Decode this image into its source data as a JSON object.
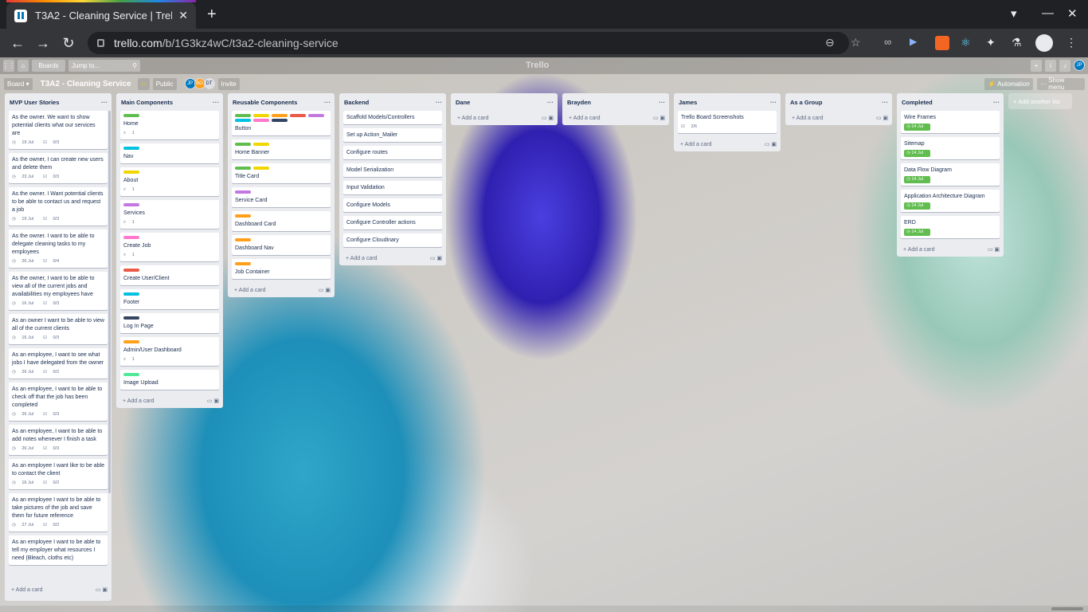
{
  "browser": {
    "tab_title": "T3A2 - Cleaning Service | Trello",
    "url_domain": "trello.com",
    "url_path": "/b/1G3kz4wC/t3a2-cleaning-service"
  },
  "topbar": {
    "boards_label": "Boards",
    "search_placeholder": "Jump to...",
    "logo": "Trello",
    "user_initials": "JP"
  },
  "board": {
    "view_label": "Board",
    "title": "T3A2 - Cleaning Service",
    "visibility": "Public",
    "invite_label": "Invite",
    "members": [
      "JP",
      "BG",
      "DT"
    ],
    "automation_label": "Automation",
    "show_menu_label": "Show menu",
    "add_list_label": "Add another list",
    "add_card_label": "Add a card"
  },
  "colors": {
    "green": "#61bd4f",
    "yellow": "#f2d600",
    "orange": "#ff9f1a",
    "red": "#eb5a46",
    "purple": "#c377e0",
    "blue": "#0079bf",
    "sky": "#00c2e0",
    "pink": "#ff78cb",
    "black": "#344563",
    "lime": "#51e898"
  },
  "lists": [
    {
      "name": "MVP User Stories",
      "cards": [
        {
          "title": "As the owner. We want to show potential clients what our services are",
          "due": "19 Jul",
          "check": "0/3"
        },
        {
          "title": "As the owner, I can create new users and delete them",
          "due": "23 Jul",
          "check": "0/3"
        },
        {
          "title": "As the owner. I Want potential clients to be able to contact us and request a job",
          "due": "19 Jul",
          "check": "0/3"
        },
        {
          "title": "As the owner. I want to be able to delegate cleaning tasks to my employees",
          "due": "26 Jul",
          "check": "0/4"
        },
        {
          "title": "As the owner, I want to be able to view all of the current jobs and availabilities my employees have",
          "due": "16 Jul",
          "check": "0/3"
        },
        {
          "title": "As an owner I want to be able to view all of the current clients",
          "due": "16 Jul",
          "check": "0/3"
        },
        {
          "title": "As an employee, I want to see what jobs I have delegated from the owner",
          "due": "26 Jul",
          "check": "0/2"
        },
        {
          "title": "As an employee, I want to be able to check off that the job has been completed",
          "due": "26 Jul",
          "check": "0/3"
        },
        {
          "title": "As an employee, I want to be able to add notes whenever I finish a task",
          "due": "26 Jul",
          "check": "0/3"
        },
        {
          "title": "As an employee I want like to be able to contact the client",
          "due": "16 Jul",
          "check": "0/2"
        },
        {
          "title": "As an employee I want to be able to take pictures of the job and save them for future reference",
          "due": "27 Jul",
          "check": "0/2"
        },
        {
          "title": "As an employee I want to be able to tell my employer what resources I need (Bleach, cloths etc)",
          "due": "",
          "check": ""
        }
      ]
    },
    {
      "name": "Main Components",
      "cards": [
        {
          "title": "Home",
          "labels": [
            "green"
          ],
          "attach": "1"
        },
        {
          "title": "Nav",
          "labels": [
            "sky"
          ]
        },
        {
          "title": "About",
          "labels": [
            "yellow"
          ],
          "attach": "1"
        },
        {
          "title": "Services",
          "labels": [
            "purple"
          ],
          "attach": "1"
        },
        {
          "title": "Create Job",
          "labels": [
            "pink"
          ],
          "attach": "1"
        },
        {
          "title": "Create User/Client",
          "labels": [
            "red"
          ]
        },
        {
          "title": "Footer",
          "labels": [
            "sky"
          ]
        },
        {
          "title": "Log In Page",
          "labels": [
            "black"
          ]
        },
        {
          "title": "Admin/User Dashboard",
          "labels": [
            "orange"
          ],
          "attach": "1"
        },
        {
          "title": "Image Upload",
          "labels": [
            "lime"
          ]
        }
      ]
    },
    {
      "name": "Reusable Components",
      "cards": [
        {
          "title": "Button",
          "labels": [
            "green",
            "yellow",
            "orange",
            "red",
            "purple",
            "sky",
            "pink",
            "black"
          ]
        },
        {
          "title": "Home Banner",
          "labels": [
            "green",
            "yellow"
          ]
        },
        {
          "title": "Title Card",
          "labels": [
            "green",
            "yellow"
          ]
        },
        {
          "title": "Service Card",
          "labels": [
            "purple"
          ]
        },
        {
          "title": "Dashboard Card",
          "labels": [
            "orange"
          ]
        },
        {
          "title": "Dashboard Nav",
          "labels": [
            "orange"
          ]
        },
        {
          "title": "Job Container",
          "labels": [
            "orange"
          ]
        }
      ]
    },
    {
      "name": "Backend",
      "cards": [
        {
          "title": "Scaffold Models/Controllers"
        },
        {
          "title": "Set up Action_Mailer"
        },
        {
          "title": "Configure routes"
        },
        {
          "title": "Model Serialization"
        },
        {
          "title": "Input Validation"
        },
        {
          "title": "Configure Models"
        },
        {
          "title": "Configure Controller actions"
        },
        {
          "title": "Configure Cloudinary"
        }
      ]
    },
    {
      "name": "Dane",
      "cards": []
    },
    {
      "name": "Brayden",
      "cards": []
    },
    {
      "name": "James",
      "cards": [
        {
          "title": "Trello Board Screenshots",
          "check": "2/6"
        }
      ]
    },
    {
      "name": "As a Group",
      "cards": []
    },
    {
      "name": "Completed",
      "cards": [
        {
          "title": "Wire Frames",
          "due": "14 Jul",
          "done": true
        },
        {
          "title": "Sitemap",
          "due": "14 Jul",
          "done": true
        },
        {
          "title": "Data Flow Diagram",
          "due": "14 Jul",
          "done": true
        },
        {
          "title": "Application Architecture Diagram",
          "due": "14 Jul",
          "done": true
        },
        {
          "title": "ERD",
          "due": "14 Jul",
          "done": true
        }
      ]
    }
  ]
}
